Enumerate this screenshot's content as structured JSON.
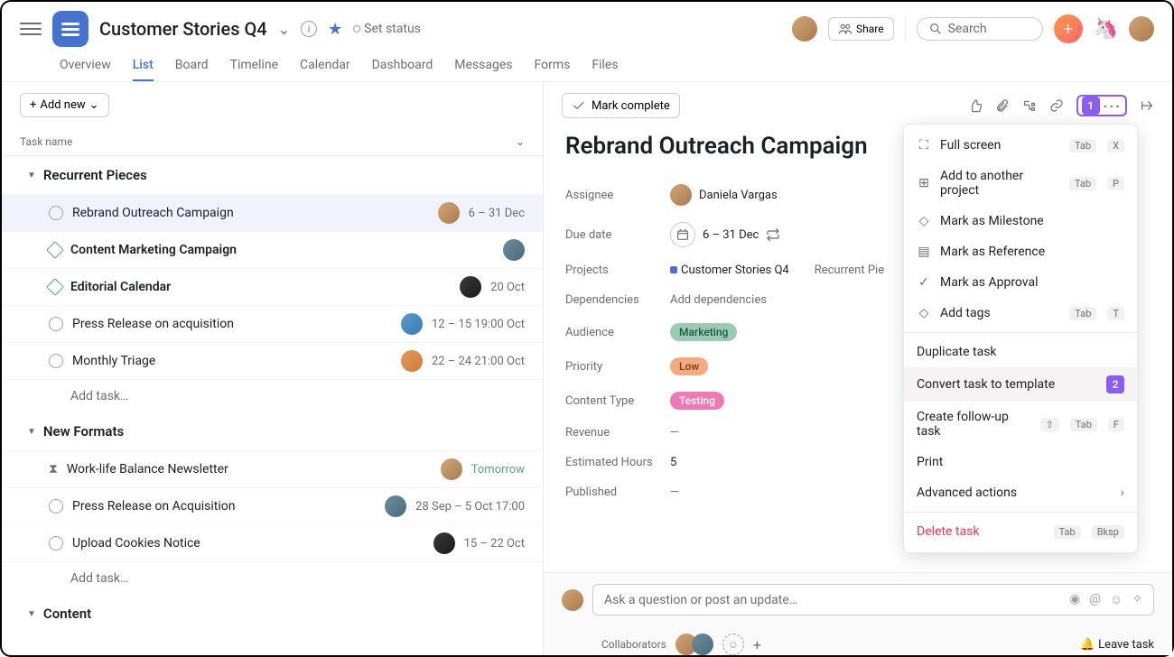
{
  "header": {
    "project_title": "Customer Stories Q4",
    "set_status": "Set status",
    "share": "Share",
    "search_placeholder": "Search"
  },
  "tabs": [
    "Overview",
    "List",
    "Board",
    "Timeline",
    "Calendar",
    "Dashboard",
    "Messages",
    "Forms",
    "Files"
  ],
  "active_tab": "List",
  "list": {
    "add_new": "Add new",
    "col_name": "Task name",
    "add_task": "Add task…",
    "sections": [
      {
        "name": "Recurrent Pieces",
        "tasks": [
          {
            "name": "Rebrand Outreach Campaign",
            "date": "6 – 31 Dec",
            "icon": "circle",
            "selected": true
          },
          {
            "name": "Content Marketing Campaign",
            "date": "",
            "icon": "milestone",
            "bold": true
          },
          {
            "name": "Editorial Calendar",
            "date": "20 Oct",
            "icon": "milestone",
            "bold": true
          },
          {
            "name": "Press Release on acquisition",
            "date": "12 – 15 19:00 Oct",
            "icon": "circle"
          },
          {
            "name": "Monthly Triage",
            "date": "22 – 24 21:00 Oct",
            "icon": "circle"
          }
        ]
      },
      {
        "name": "New Formats",
        "tasks": [
          {
            "name": "Work-life Balance Newsletter",
            "date": "Tomorrow",
            "date_green": true,
            "icon": "hourglass"
          },
          {
            "name": "Press Release on Acquisition",
            "date": "28 Sep – 5 Oct 17:00",
            "icon": "circle"
          },
          {
            "name": "Upload Cookies Notice",
            "date": "15 – 22 Oct",
            "icon": "circle"
          }
        ]
      },
      {
        "name": "Content",
        "tasks": []
      }
    ]
  },
  "detail": {
    "mark_complete": "Mark complete",
    "title": "Rebrand Outreach Campaign",
    "fields": {
      "assignee_label": "Assignee",
      "assignee_value": "Daniela Vargas",
      "due_label": "Due date",
      "due_value": "6 – 31 Dec",
      "projects_label": "Projects",
      "projects_value": "Customer Stories Q4",
      "projects_extra": "Recurrent Pie",
      "deps_label": "Dependencies",
      "deps_value": "Add dependencies",
      "audience_label": "Audience",
      "audience_value": "Marketing",
      "priority_label": "Priority",
      "priority_value": "Low",
      "content_type_label": "Content Type",
      "content_type_value": "Testing",
      "revenue_label": "Revenue",
      "revenue_value": "—",
      "est_hours_label": "Estimated Hours",
      "est_hours_value": "5",
      "published_label": "Published",
      "published_value": "—"
    },
    "comment_placeholder": "Ask a question or post an update…",
    "collaborators_label": "Collaborators",
    "leave_task": "Leave task"
  },
  "menu": {
    "callout1": "1",
    "callout2": "2",
    "items": [
      {
        "icon": "⛶",
        "label": "Full screen",
        "kbd": [
          "Tab",
          "X"
        ]
      },
      {
        "icon": "⊞",
        "label": "Add to another project",
        "kbd": [
          "Tab",
          "P"
        ]
      },
      {
        "icon": "◇",
        "label": "Mark as Milestone"
      },
      {
        "icon": "▤",
        "label": "Mark as Reference"
      },
      {
        "icon": "✓",
        "label": "Mark as Approval"
      },
      {
        "icon": "◇",
        "label": "Add tags",
        "kbd": [
          "Tab",
          "T"
        ]
      }
    ],
    "group2": [
      {
        "label": "Duplicate task"
      },
      {
        "label": "Convert task to template",
        "badge": "2",
        "hover": true
      },
      {
        "label": "Create follow-up task",
        "kbd": [
          "⇧",
          "Tab",
          "F"
        ]
      },
      {
        "label": "Print"
      },
      {
        "label": "Advanced actions",
        "chevron": true
      }
    ],
    "delete": {
      "label": "Delete task",
      "kbd": [
        "Tab",
        "Bksp"
      ]
    }
  }
}
